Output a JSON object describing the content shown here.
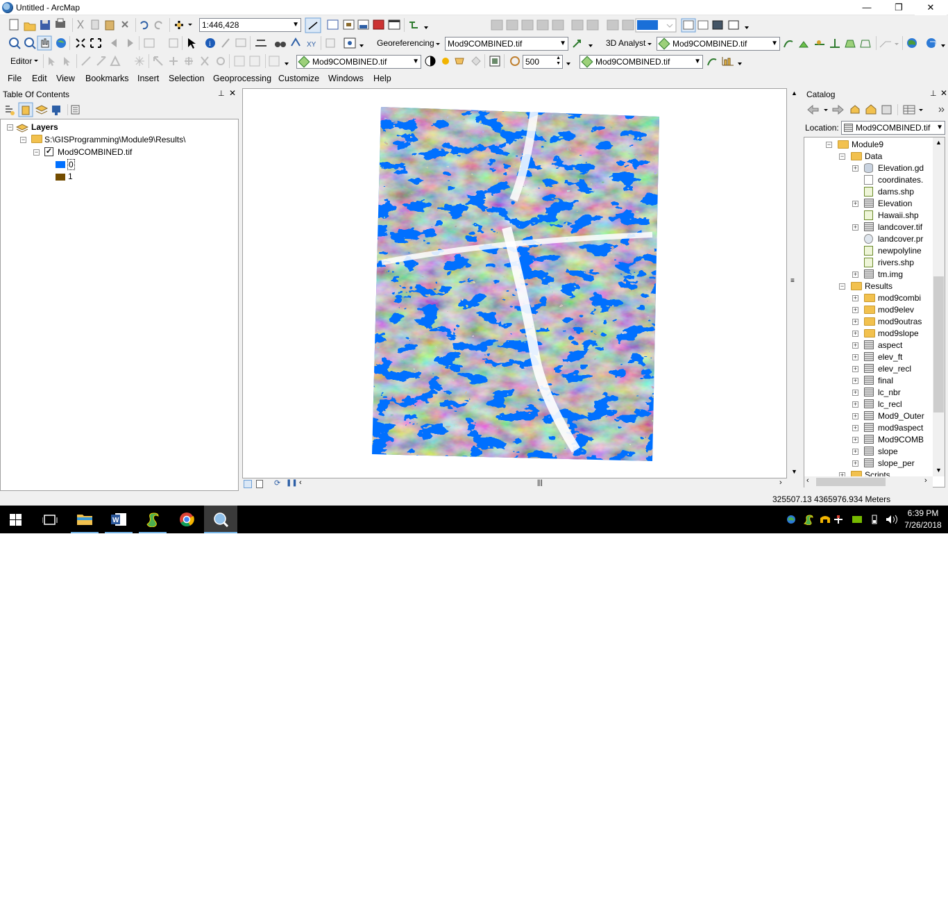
{
  "window": {
    "title": "Untitled - ArcMap",
    "minimize": "—",
    "restore": "❐",
    "close": "✕"
  },
  "toolbar1": {
    "scale": "1:446,428"
  },
  "toolbar2": {
    "georeferencing": "Georeferencing",
    "georef_layer": "Mod9COMBINED.tif",
    "analyst": "3D Analyst",
    "analyst_layer": "Mod9COMBINED.tif"
  },
  "toolbar3": {
    "editor": "Editor",
    "layer_a": "Mod9COMBINED.tif",
    "value": "500",
    "layer_b": "Mod9COMBINED.tif"
  },
  "menu": [
    "File",
    "Edit",
    "View",
    "Bookmarks",
    "Insert",
    "Selection",
    "Geoprocessing",
    "Customize",
    "Windows",
    "Help"
  ],
  "toc": {
    "title": "Table Of Contents",
    "layers_label": "Layers",
    "path": "S:\\GISProgramming\\Module9\\Results\\",
    "layer_name": "Mod9COMBINED.tif",
    "legend": [
      {
        "label": "0",
        "color": "#0070ff"
      },
      {
        "label": "1",
        "color": "#734c00"
      }
    ]
  },
  "catalog": {
    "title": "Catalog",
    "location_label": "Location:",
    "location_value": "Mod9COMBINED.tif",
    "items": [
      {
        "label": "Module9",
        "icon": "folder",
        "indent": 0,
        "exp": "-"
      },
      {
        "label": "Data",
        "icon": "folder",
        "indent": 1,
        "exp": "-"
      },
      {
        "label": "Elevation.gd",
        "icon": "database",
        "indent": 2,
        "exp": "+"
      },
      {
        "label": "coordinates.",
        "icon": "text-file",
        "indent": 2,
        "exp": ""
      },
      {
        "label": "dams.shp",
        "icon": "point-shapefile",
        "indent": 2,
        "exp": ""
      },
      {
        "label": "Elevation",
        "icon": "raster",
        "indent": 2,
        "exp": "+"
      },
      {
        "label": "Hawaii.shp",
        "icon": "polygon-shapefile",
        "indent": 2,
        "exp": ""
      },
      {
        "label": "landcover.tif",
        "icon": "raster",
        "indent": 2,
        "exp": "+"
      },
      {
        "label": "landcover.pr",
        "icon": "projection-file",
        "indent": 2,
        "exp": ""
      },
      {
        "label": "newpolyline",
        "icon": "line-shapefile",
        "indent": 2,
        "exp": ""
      },
      {
        "label": "rivers.shp",
        "icon": "line-shapefile",
        "indent": 2,
        "exp": ""
      },
      {
        "label": "tm.img",
        "icon": "raster",
        "indent": 2,
        "exp": "+"
      },
      {
        "label": "Results",
        "icon": "folder",
        "indent": 1,
        "exp": "-"
      },
      {
        "label": "mod9combi",
        "icon": "folder",
        "indent": 2,
        "exp": "+"
      },
      {
        "label": "mod9elev",
        "icon": "folder",
        "indent": 2,
        "exp": "+"
      },
      {
        "label": "mod9outras",
        "icon": "folder",
        "indent": 2,
        "exp": "+"
      },
      {
        "label": "mod9slope",
        "icon": "folder",
        "indent": 2,
        "exp": "+"
      },
      {
        "label": "aspect",
        "icon": "raster",
        "indent": 2,
        "exp": "+"
      },
      {
        "label": "elev_ft",
        "icon": "raster",
        "indent": 2,
        "exp": "+"
      },
      {
        "label": "elev_recl",
        "icon": "raster",
        "indent": 2,
        "exp": "+"
      },
      {
        "label": "final",
        "icon": "raster",
        "indent": 2,
        "exp": "+"
      },
      {
        "label": "lc_nbr",
        "icon": "raster",
        "indent": 2,
        "exp": "+"
      },
      {
        "label": "lc_recl",
        "icon": "raster",
        "indent": 2,
        "exp": "+"
      },
      {
        "label": "Mod9_Outer",
        "icon": "raster",
        "indent": 2,
        "exp": "+"
      },
      {
        "label": "mod9aspect",
        "icon": "raster",
        "indent": 2,
        "exp": "+"
      },
      {
        "label": "Mod9COMB",
        "icon": "raster",
        "indent": 2,
        "exp": "+"
      },
      {
        "label": "slope",
        "icon": "raster",
        "indent": 2,
        "exp": "+"
      },
      {
        "label": "slope_per",
        "icon": "raster",
        "indent": 2,
        "exp": "+"
      },
      {
        "label": "Scripts",
        "icon": "folder",
        "indent": 1,
        "exp": "+"
      }
    ]
  },
  "status": {
    "coordinates": "325507.13  4365976.934 Meters"
  },
  "taskbar": {
    "time": "6:39 PM",
    "date": "7/26/2018"
  },
  "colors": {
    "class0": "#0070ff",
    "class1": "#734c00"
  }
}
